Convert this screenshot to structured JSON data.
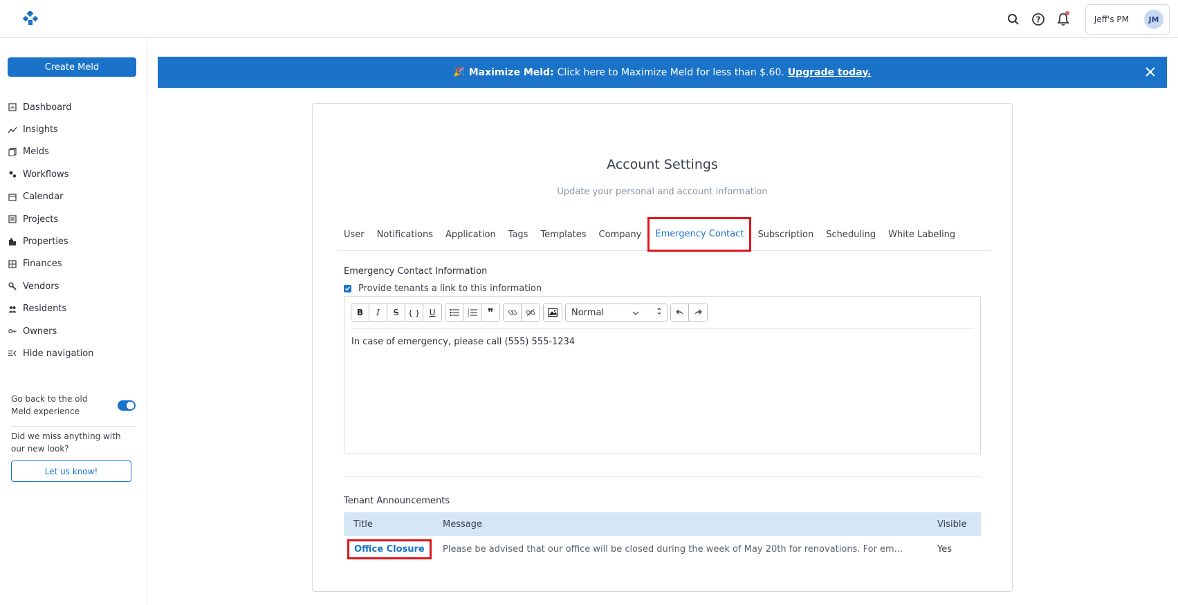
{
  "header": {
    "account_name": "Jeff's PM",
    "avatar_initials": "JM"
  },
  "sidebar": {
    "create_button": "Create Meld",
    "items": [
      {
        "label": "Dashboard",
        "icon": "dashboard-icon"
      },
      {
        "label": "Insights",
        "icon": "insights-icon"
      },
      {
        "label": "Melds",
        "icon": "melds-icon"
      },
      {
        "label": "Workflows",
        "icon": "workflows-icon"
      },
      {
        "label": "Calendar",
        "icon": "calendar-icon"
      },
      {
        "label": "Projects",
        "icon": "projects-icon"
      },
      {
        "label": "Properties",
        "icon": "properties-icon"
      },
      {
        "label": "Finances",
        "icon": "finances-icon"
      },
      {
        "label": "Vendors",
        "icon": "vendors-icon"
      },
      {
        "label": "Residents",
        "icon": "residents-icon"
      },
      {
        "label": "Owners",
        "icon": "owners-icon"
      },
      {
        "label": "Hide navigation",
        "icon": "hide-navigation-icon"
      }
    ],
    "toggle_label": "Go back to the old Meld experience",
    "toggle_on": true,
    "feedback_text": "Did we miss anything with our new look?",
    "feedback_button": "Let us know!"
  },
  "banner": {
    "bold": "Maximize Meld:",
    "text": "Click here to Maximize Meld for less than $.60.",
    "link": "Upgrade today."
  },
  "page": {
    "title": "Account Settings",
    "subtitle": "Update your personal and account information"
  },
  "tabs": [
    {
      "label": "User"
    },
    {
      "label": "Notifications"
    },
    {
      "label": "Application"
    },
    {
      "label": "Tags"
    },
    {
      "label": "Templates"
    },
    {
      "label": "Company"
    },
    {
      "label": "Emergency Contact",
      "active": true
    },
    {
      "label": "Subscription"
    },
    {
      "label": "Scheduling"
    },
    {
      "label": "White Labeling"
    }
  ],
  "emergency": {
    "section_title": "Emergency Contact Information",
    "checkbox_label": "Provide tenants a link to this information",
    "checkbox_checked": true,
    "format_select": "Normal",
    "editor_text": "In case of emergency, please call (555) 555-1234"
  },
  "announcements": {
    "section_title": "Tenant Announcements",
    "columns": {
      "title": "Title",
      "message": "Message",
      "visible": "Visible"
    },
    "rows": [
      {
        "title": "Office Closure",
        "message": "Please be advised that our office will be closed during the week of May 20th for renovations. For em...",
        "visible": "Yes"
      }
    ]
  },
  "colors": {
    "accent": "#1a73c9",
    "highlight": "#e0141c",
    "table_header": "#d5e6f5"
  }
}
